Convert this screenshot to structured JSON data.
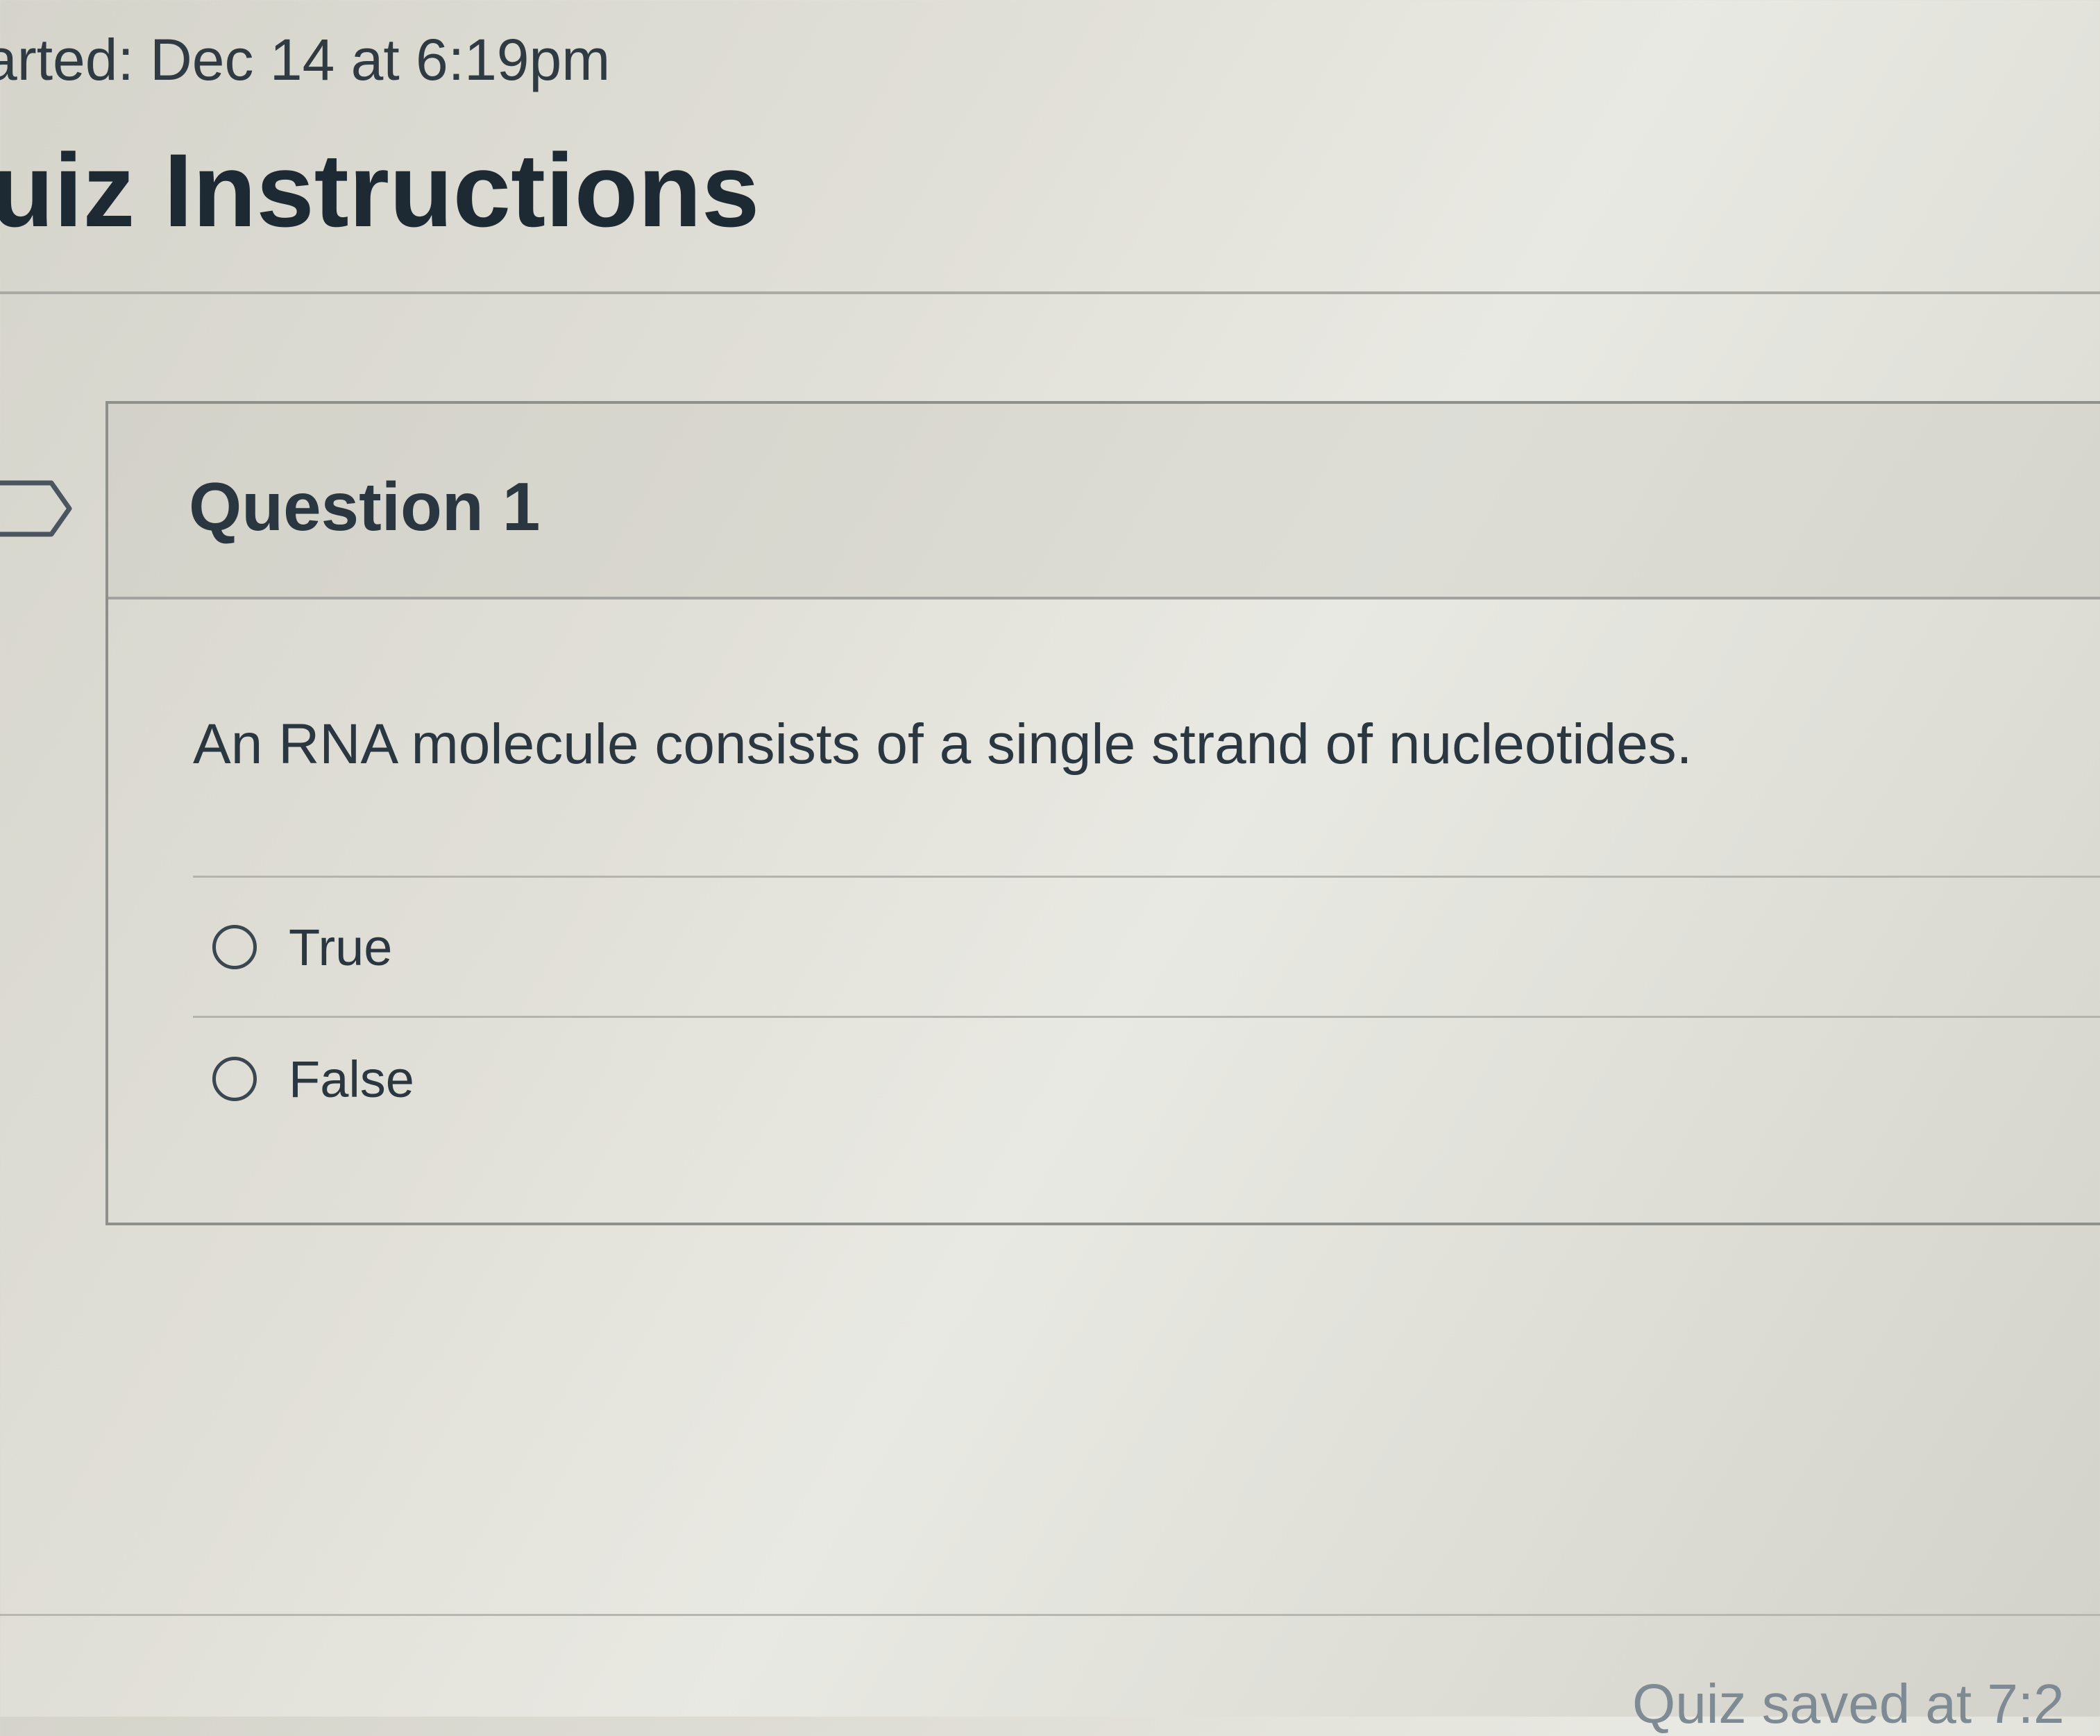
{
  "header": {
    "started_text": "arted: Dec 14 at 6:19pm",
    "title": "uiz Instructions"
  },
  "question": {
    "title": "Question 1",
    "text": "An RNA molecule consists of a single strand of nucleotides.",
    "flag_icon": "bookmark-flag-icon",
    "answers": [
      {
        "label": "True",
        "selected": false
      },
      {
        "label": "False",
        "selected": false
      }
    ]
  },
  "footer": {
    "saved_status": "Quiz saved at 7:2"
  }
}
